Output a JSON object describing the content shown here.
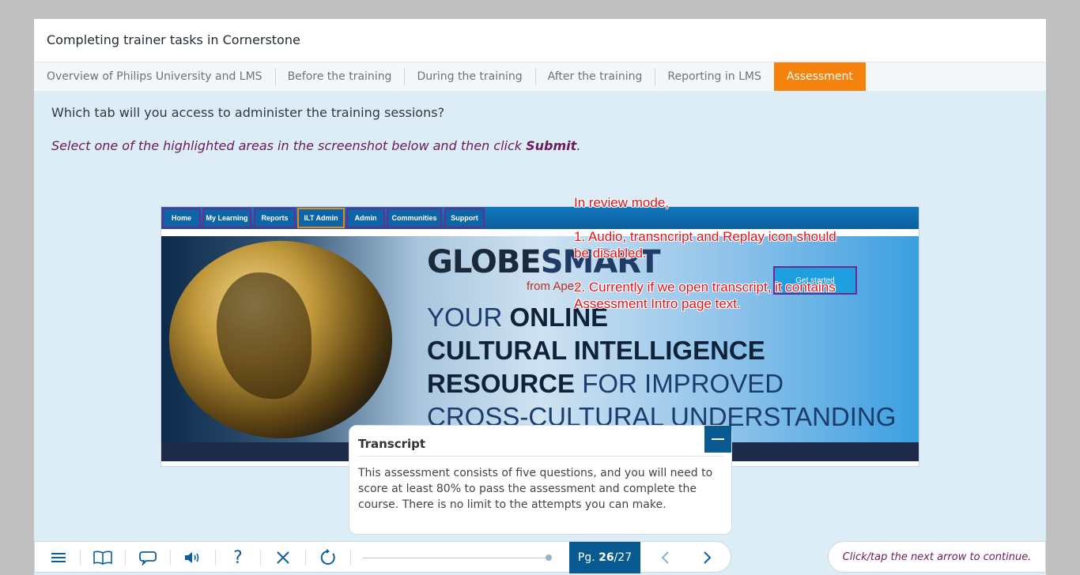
{
  "header": {
    "course_title": "Completing trainer tasks in Cornerstone"
  },
  "tabs": [
    {
      "label": "Overview of Philips University and LMS",
      "active": false
    },
    {
      "label": "Before the training",
      "active": false
    },
    {
      "label": "During the training",
      "active": false
    },
    {
      "label": "After the training",
      "active": false
    },
    {
      "label": "Reporting in LMS",
      "active": false
    },
    {
      "label": "Assessment",
      "active": true
    }
  ],
  "question": {
    "text": "Which tab will you access to administer the training sessions?",
    "instruction_prefix": "Select one of the highlighted areas in the screenshot below and then click ",
    "instruction_bold": "Submit",
    "instruction_suffix": "."
  },
  "screenshot": {
    "nav_items": [
      "Home",
      "My Learning",
      "Reports",
      "ILT Admin",
      "Admin",
      "Communities",
      "Support"
    ],
    "selected_nav_item": "ILT Admin",
    "logo_main": "GLOBE",
    "logo_accent": "SMART",
    "logo_sub": "from Apex",
    "tagline_1_plain": "YOUR ",
    "tagline_1_bold": "ONLINE",
    "tagline_2_bold": "CULTURAL INTELLIGENCE",
    "tagline_3_bold": "RESOURCE",
    "tagline_3_plain": " FOR IMPROVED",
    "tagline_4_plain": "CROSS-CULTURAL UNDERSTANDING",
    "get_started_label": "Get started"
  },
  "annotation": {
    "line1": "In review mode,",
    "line2": "1. Audio, transncript and Replay icon should",
    "line3": "be disabled.",
    "line4": "2. Currently if we open transcript, it contains",
    "line5": "Assessment Intro page text."
  },
  "transcript": {
    "title": "Transcript",
    "body": "This assessment consists of five questions, and you will need to score at least 80% to pass the assessment and complete the course. There is no limit to the attempts you can make."
  },
  "toolbar": {
    "icons": [
      "menu-icon",
      "book-icon",
      "chat-icon",
      "audio-icon",
      "help-icon",
      "close-icon",
      "replay-icon",
      "previous-arrow-icon",
      "next-arrow-icon"
    ],
    "help_glyph": "?",
    "page_prefix": "Pg. ",
    "page_current": "26",
    "page_total": "/27",
    "progress_fraction": 0.96,
    "continue_hint": "Click/tap the next arrow to continue."
  },
  "colors": {
    "accent_orange": "#f4820d",
    "brand_blue": "#0a5a92",
    "instruction_purple": "#6a1a5e",
    "annotation_red": "#e0141a",
    "highlight_border": "#6b2c8f"
  }
}
